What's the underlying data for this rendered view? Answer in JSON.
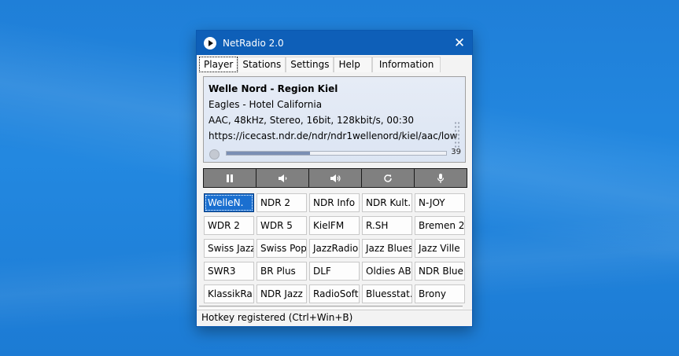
{
  "window": {
    "title": "NetRadio 2.0",
    "close_glyph": "✕"
  },
  "tabs": [
    {
      "label": "Player",
      "active": true
    },
    {
      "label": "Stations"
    },
    {
      "label": "Settings"
    },
    {
      "label": "Help"
    },
    {
      "label": "Information"
    }
  ],
  "player": {
    "station_name": "Welle Nord - Region Kiel",
    "song": "Eagles - Hotel California",
    "format": "AAC, 48kHz, Stereo, 16bit, 128kbit/s, 00:30",
    "url": "https://icecast.ndr.de/ndr/ndr1wellenord/kiel/aac/low",
    "buffer_progress": 0.38,
    "volume": "39"
  },
  "controls": [
    {
      "name": "pause-button",
      "icon": "pause-icon"
    },
    {
      "name": "volume-down-button",
      "icon": "speaker-low-icon"
    },
    {
      "name": "volume-up-button",
      "icon": "speaker-high-icon"
    },
    {
      "name": "reload-button",
      "icon": "refresh-icon"
    },
    {
      "name": "record-button",
      "icon": "microphone-icon"
    }
  ],
  "stations": [
    "WelleN.",
    "NDR 2",
    "NDR Info",
    "NDR Kult.",
    "N-JOY",
    "WDR 2",
    "WDR 5",
    "KielFM",
    "R.SH",
    "Bremen 2",
    "Swiss Jazz",
    "Swiss Pop",
    "JazzRadio",
    "Jazz Blues",
    "Jazz Ville",
    "SWR3",
    "BR Plus",
    "DLF",
    "Oldies AB",
    "NDR Blue",
    "KlassikRa",
    "NDR Jazz",
    "RadioSoft",
    "Bluesstat.",
    "Brony"
  ],
  "selected_station_index": 0,
  "status": "Hotkey registered (Ctrl+Win+B)"
}
